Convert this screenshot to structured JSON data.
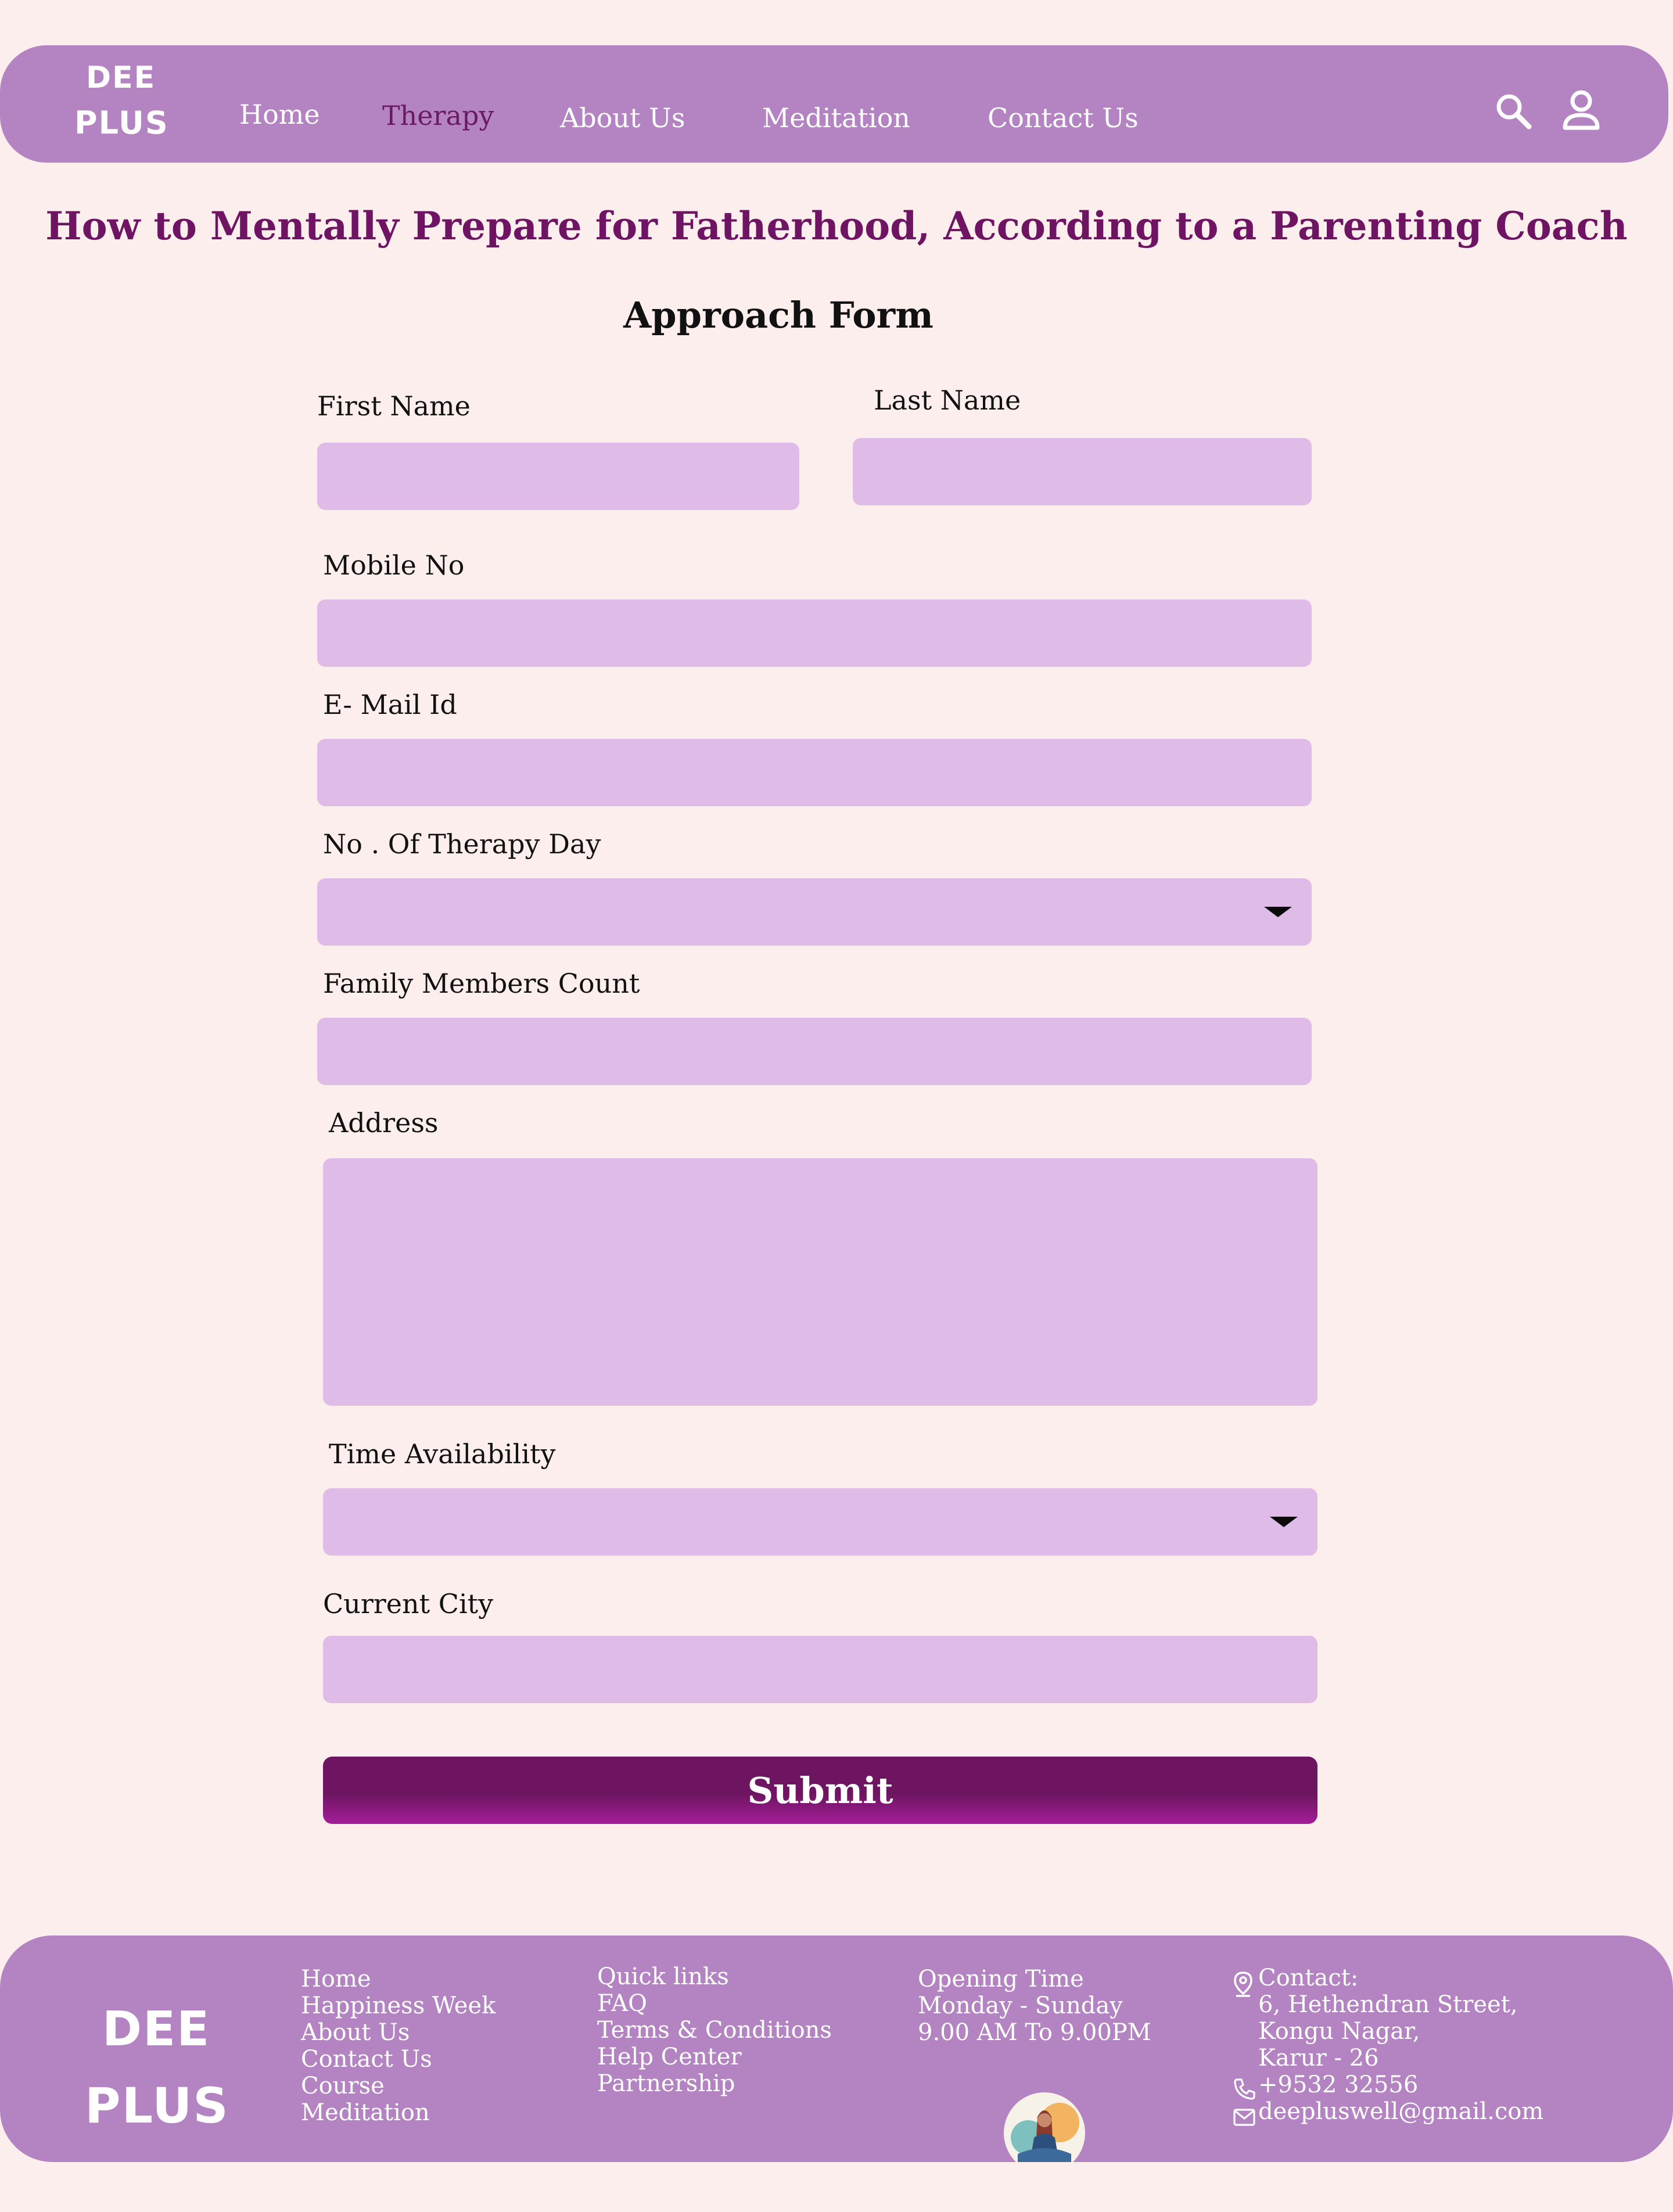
{
  "brand": {
    "line1": "DEE",
    "line2": "PLUS"
  },
  "nav": {
    "items": [
      {
        "label": "Home"
      },
      {
        "label": "Therapy"
      },
      {
        "label": "About Us"
      },
      {
        "label": "Meditation"
      },
      {
        "label": "Contact Us"
      }
    ],
    "active": "Therapy",
    "icons": [
      "search-icon",
      "user-icon"
    ]
  },
  "page": {
    "title": "How to Mentally Prepare for Fatherhood, According to a Parenting Coach",
    "form_title": "Approach Form"
  },
  "form": {
    "first_name": {
      "label": "First Name",
      "value": ""
    },
    "last_name": {
      "label": "Last Name",
      "value": ""
    },
    "mobile": {
      "label": "Mobile No",
      "value": ""
    },
    "email": {
      "label": "E- Mail Id",
      "value": ""
    },
    "therapy_days": {
      "label": "No . Of Therapy Day",
      "value": ""
    },
    "family_count": {
      "label": "Family Members Count",
      "value": ""
    },
    "address": {
      "label": "Address",
      "value": ""
    },
    "time_availability": {
      "label": "Time Availability",
      "value": ""
    },
    "current_city": {
      "label": "Current City",
      "value": ""
    },
    "submit_label": "Submit"
  },
  "footer": {
    "brand": {
      "line1": "DEE",
      "line2": "PLUS"
    },
    "links": [
      "Home",
      "Happiness Week",
      "About Us",
      "Contact Us",
      "Course",
      "Meditation"
    ],
    "quick_links": [
      "Quick links",
      "FAQ",
      "Terms & Conditions",
      "Help Center",
      "Partnership"
    ],
    "opening": [
      "Opening Time",
      "Monday - Sunday",
      "9.00 AM To 9.00PM"
    ],
    "contact": {
      "heading": "Contact:",
      "address": [
        "6, Hethendran Street,",
        "Kongu Nagar,",
        "Karur - 26"
      ],
      "phone": "+9532 32556",
      "email": "deepluswell@gmail.com"
    }
  },
  "colors": {
    "page_bg": "#fdeeee",
    "bar": "#b384c1",
    "accent": "#6e1463",
    "field": "#dfbbe7"
  }
}
